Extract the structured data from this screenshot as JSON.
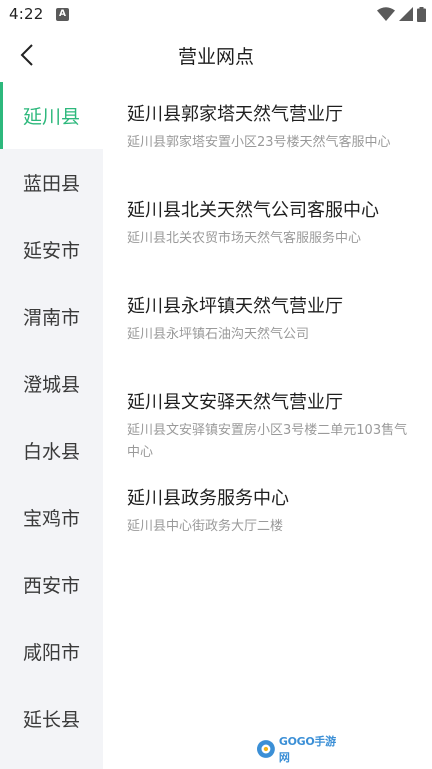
{
  "status_bar": {
    "time": "4:22",
    "notification_icon": "A"
  },
  "header": {
    "title": "营业网点"
  },
  "sidebar": {
    "items": [
      {
        "label": "延川县",
        "active": true
      },
      {
        "label": "蓝田县",
        "active": false
      },
      {
        "label": "延安市",
        "active": false
      },
      {
        "label": "渭南市",
        "active": false
      },
      {
        "label": "澄城县",
        "active": false
      },
      {
        "label": "白水县",
        "active": false
      },
      {
        "label": "宝鸡市",
        "active": false
      },
      {
        "label": "西安市",
        "active": false
      },
      {
        "label": "咸阳市",
        "active": false
      },
      {
        "label": "延长县",
        "active": false
      }
    ]
  },
  "outlets": [
    {
      "name": "延川县郭家塔天然气营业厅",
      "address": "延川县郭家塔安置小区23号楼天然气客服中心"
    },
    {
      "name": "延川县北关天然气公司客服中心",
      "address": "延川县北关农贸市场天然气客服服务中心"
    },
    {
      "name": "延川县永坪镇天然气营业厅",
      "address": "延川县永坪镇石油沟天然气公司"
    },
    {
      "name": "延川县文安驿天然气营业厅",
      "address": "延川县文安驿镇安置房小区3号楼二单元103售气中心"
    },
    {
      "name": "延川县政务服务中心",
      "address": "延川县中心街政务大厅二楼"
    }
  ],
  "watermark": {
    "text": "GOGO手游网"
  },
  "colors": {
    "accent": "#2db87c",
    "sidebar_bg": "#f3f4f7",
    "address_text": "#9a9a9a"
  }
}
